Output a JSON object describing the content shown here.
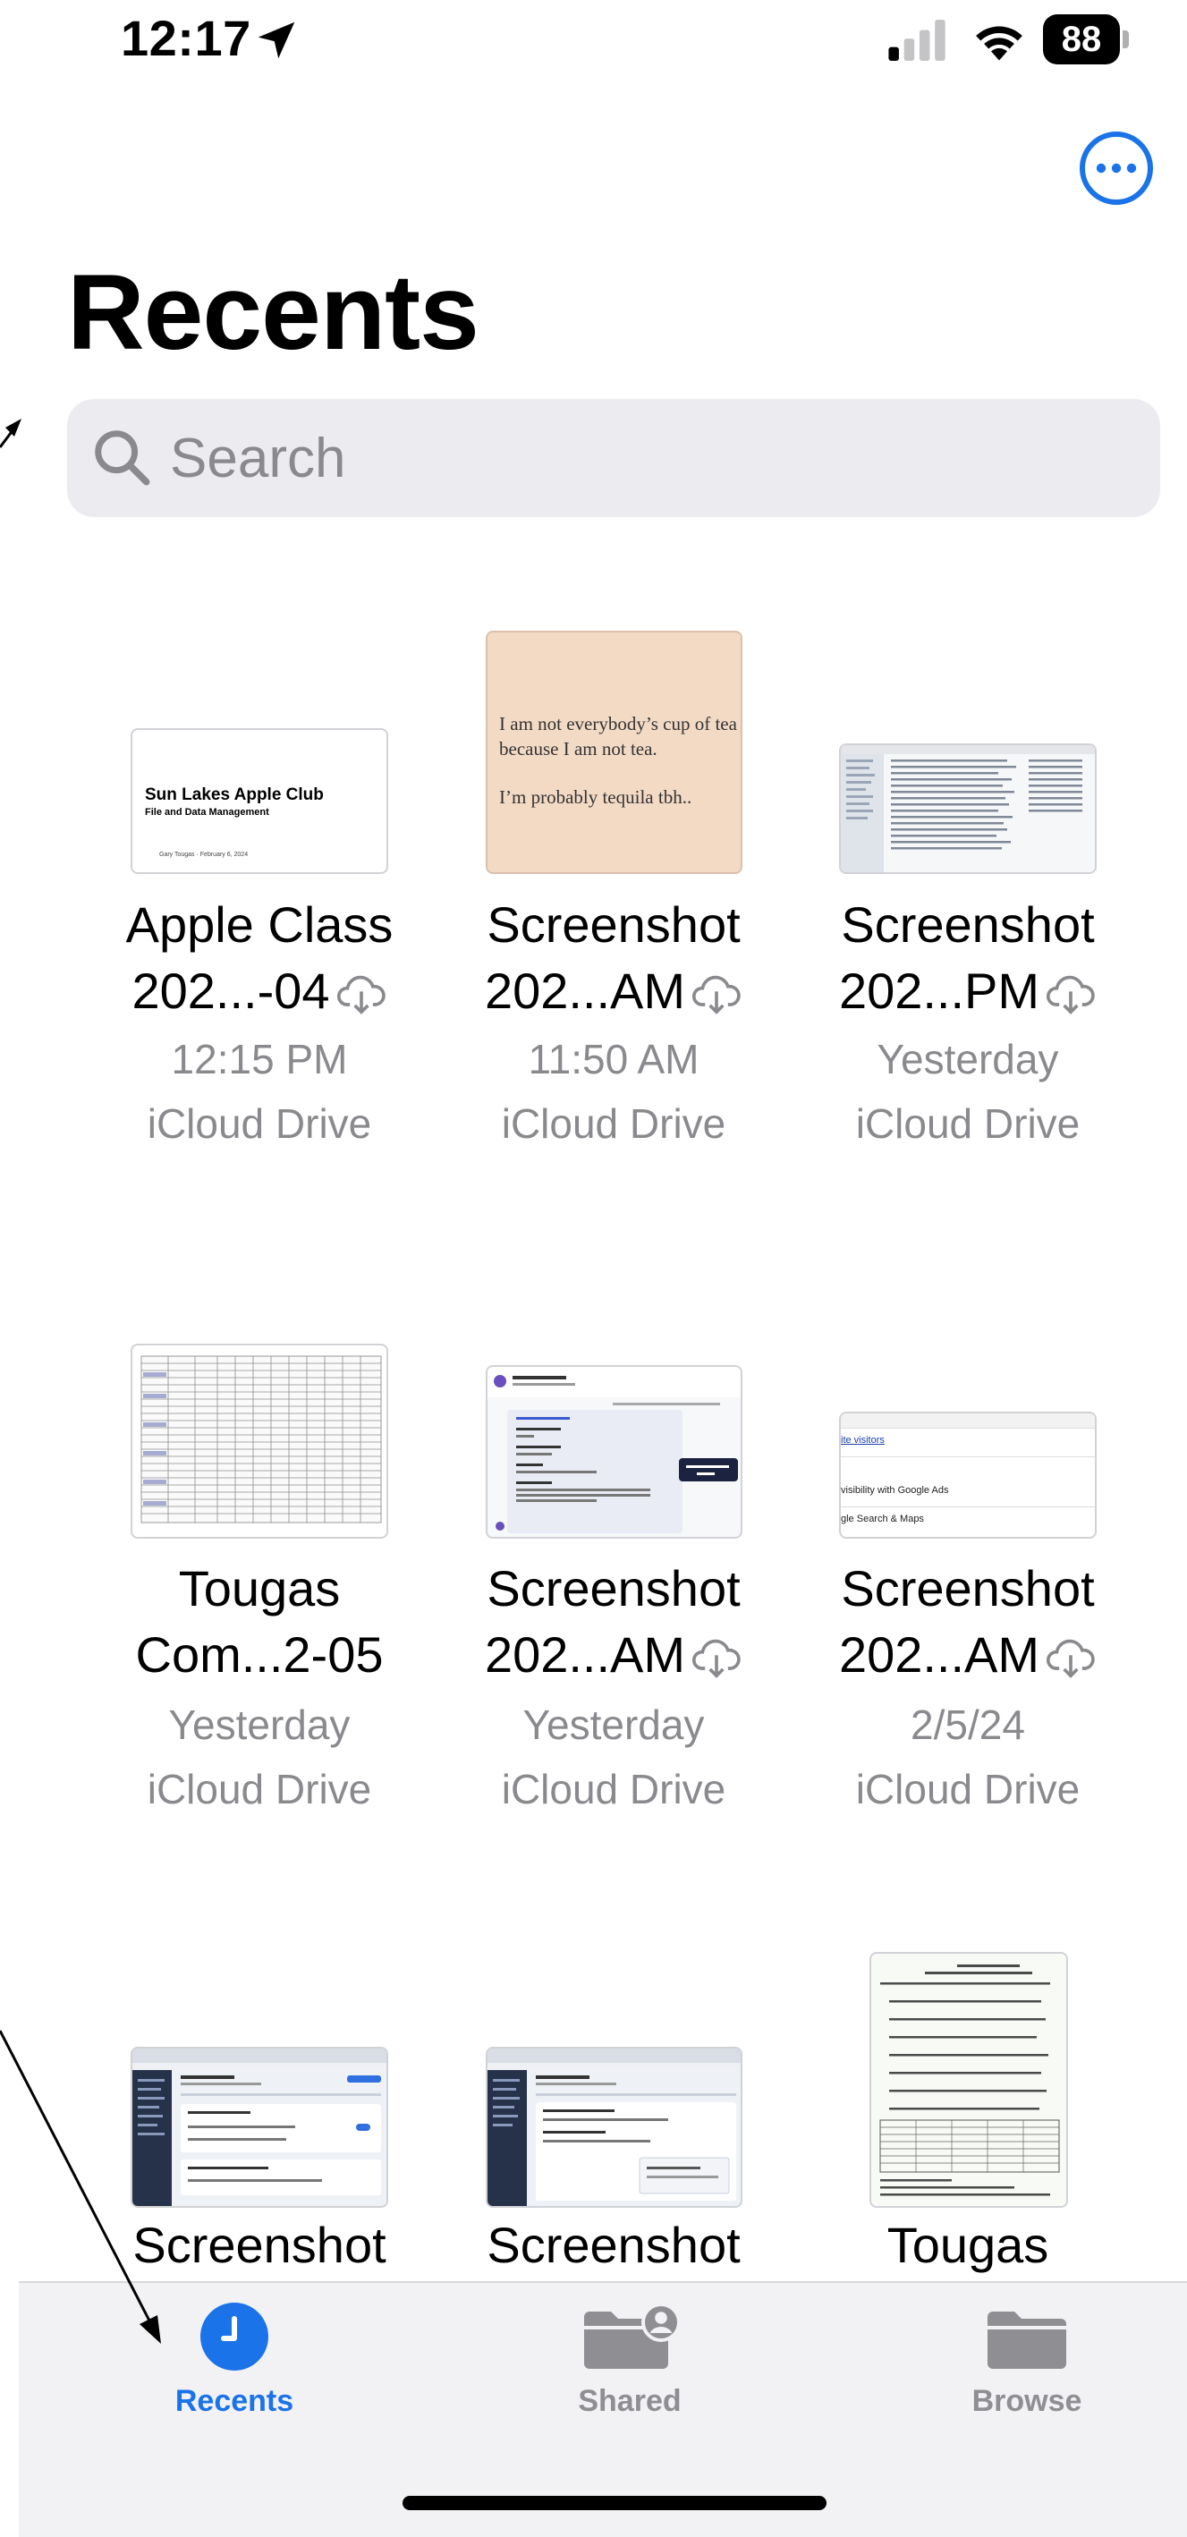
{
  "status_bar": {
    "time": "12:17",
    "battery": "88"
  },
  "header": {
    "title": "Recents",
    "more_icon": "ellipsis-circle-icon"
  },
  "search": {
    "placeholder": "Search",
    "value": ""
  },
  "files": [
    {
      "name_line1": "Apple Class",
      "name_line2": "202...-04",
      "cloud": true,
      "time": "12:15 PM",
      "location": "iCloud Drive",
      "thumb_title": "Sun Lakes Apple Club",
      "thumb_subtitle": "File and Data Management",
      "thumb_footer": "Gary Tougas · February 6, 2024"
    },
    {
      "name_line1": "Screenshot",
      "name_line2": "202...AM",
      "cloud": true,
      "time": "11:50 AM",
      "location": "iCloud Drive",
      "thumb_line1": "I am not everybody’s cup of tea",
      "thumb_line2": "because I am not tea.",
      "thumb_line3": "I’m probably tequila tbh.."
    },
    {
      "name_line1": "Screenshot",
      "name_line2": "202...PM",
      "cloud": true,
      "time": "Yesterday",
      "location": "iCloud Drive"
    },
    {
      "name_line1": "Tougas",
      "name_line2": "Com...2-05",
      "cloud": false,
      "time": "Yesterday",
      "location": "iCloud Drive"
    },
    {
      "name_line1": "Screenshot",
      "name_line2": "202...AM",
      "cloud": true,
      "time": "Yesterday",
      "location": "iCloud Drive"
    },
    {
      "name_line1": "Screenshot",
      "name_line2": "202...AM",
      "cloud": true,
      "time": "2/5/24",
      "location": "iCloud Drive",
      "thumb_line1": "ite visitors",
      "thumb_line2": "visibility with Google Ads",
      "thumb_line3": "gle Search & Maps"
    },
    {
      "name_line1": "Screenshot"
    },
    {
      "name_line1": "Screenshot"
    },
    {
      "name_line1": "Tougas"
    }
  ],
  "tabs": [
    {
      "label": "Recents",
      "icon": "clock-icon",
      "active": true
    },
    {
      "label": "Shared",
      "icon": "shared-folder-icon",
      "active": false
    },
    {
      "label": "Browse",
      "icon": "folder-icon",
      "active": false
    }
  ],
  "colors": {
    "accent": "#1a73e8",
    "tab_inactive": "#8e8e93",
    "secondary_text": "#8a8a8e"
  }
}
